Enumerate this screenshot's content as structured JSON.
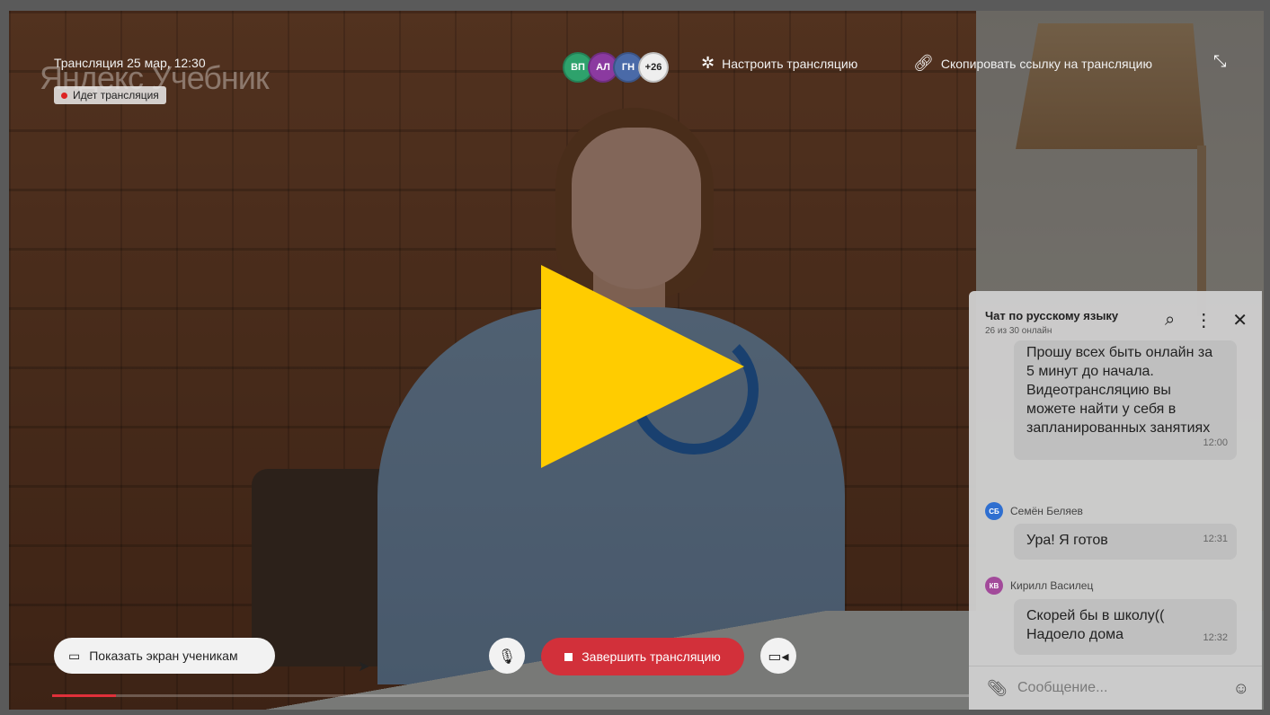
{
  "stream": {
    "title": "Трансляция 25 мар, 12:30",
    "live_label": "Идет трансляция",
    "watermark": "Яндекс Учебник",
    "progress_fraction": 0.07
  },
  "participants": {
    "avatars": [
      {
        "initials": "ВП",
        "color": "#2ea26c"
      },
      {
        "initials": "АЛ",
        "color": "#8b3aa0"
      },
      {
        "initials": "ГН",
        "color": "#4a6aa8"
      }
    ],
    "more_count": "+26"
  },
  "toolbar": {
    "settings_label": "Настроить трансляцию",
    "copy_link_label": "Скопировать ссылку на трансляцию"
  },
  "controls": {
    "show_screen_label": "Показать экран ученикам",
    "end_stream_label": "Завершить трансляцию"
  },
  "chat": {
    "title": "Чат по русскому языку",
    "online": "26 из 30 онлайн",
    "messages": [
      {
        "text": "Прошу всех быть онлайн за 5 минут до начала. Видеотрансляцию вы можете найти у себя в запланированных занятиях",
        "time": "12:00"
      },
      {
        "sender": "Семён Беляев",
        "initials": "СБ",
        "color": "#2f6fd0",
        "text": "Ура! Я готов",
        "time": "12:31"
      },
      {
        "sender": "Кирилл Василец",
        "initials": "КВ",
        "color": "#a24a9a",
        "text": "Скорей бы в школу(( Надоело дома",
        "time": "12:32"
      }
    ],
    "input_placeholder": "Сообщение..."
  },
  "colors": {
    "play": "#ffcc00",
    "end_button": "#d2303a",
    "progress": "#e0303a"
  },
  "icons": [
    "settings-gear-icon",
    "link-icon",
    "collapse-icon",
    "play-icon",
    "screen-share-icon",
    "microphone-icon",
    "stop-icon",
    "camera-icon",
    "search-icon",
    "more-vertical-icon",
    "close-icon",
    "paperclip-icon",
    "emoji-icon"
  ]
}
